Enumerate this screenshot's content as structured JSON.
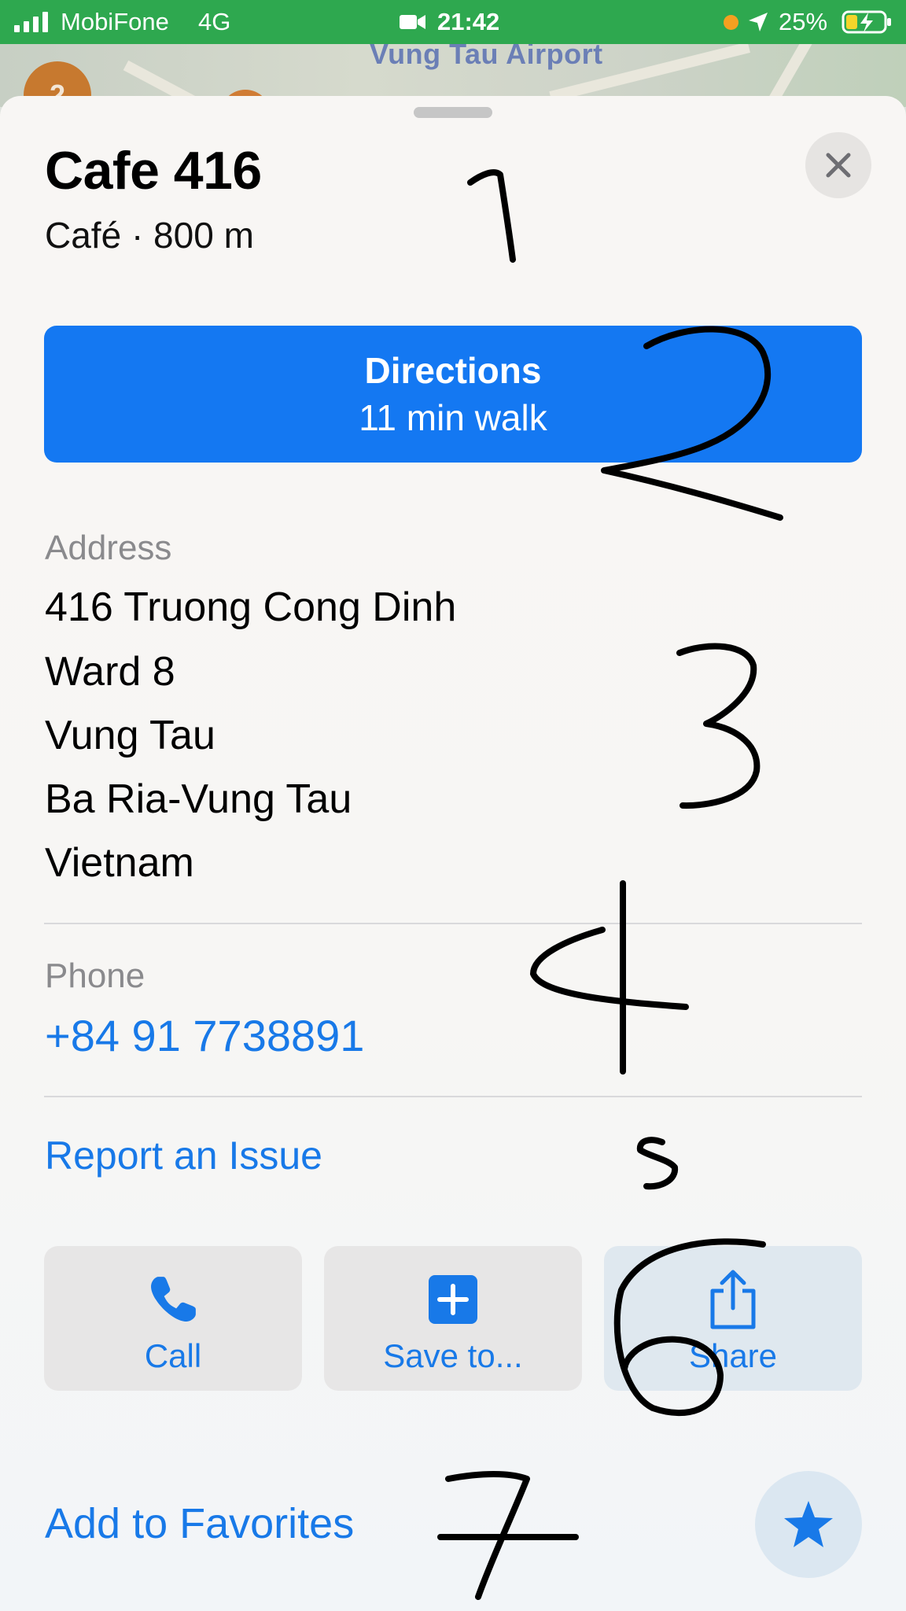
{
  "status_bar": {
    "carrier": "MobiFone",
    "network": "4G",
    "time": "21:42",
    "battery": "25%"
  },
  "map": {
    "label": "Vung Tau Airport",
    "cluster_count": "2"
  },
  "place": {
    "title": "Cafe 416",
    "subtitle": "Café · 800 m"
  },
  "directions": {
    "label": "Directions",
    "sub": "11 min walk"
  },
  "address": {
    "label": "Address",
    "lines": [
      "416 Truong Cong Dinh",
      "Ward 8",
      "Vung Tau",
      "Ba Ria-Vung Tau",
      "Vietnam"
    ]
  },
  "phone": {
    "label": "Phone",
    "value": "+84 91 7738891"
  },
  "report_issue": "Report an Issue",
  "actions": [
    {
      "label": "Call",
      "icon": "phone-icon"
    },
    {
      "label": "Save to...",
      "icon": "plus-icon"
    },
    {
      "label": "Share",
      "icon": "share-icon"
    }
  ],
  "add_favorites": "Add to Favorites",
  "annotations": [
    "1",
    "2",
    "3",
    "4",
    "5",
    "6",
    "7"
  ],
  "colors": {
    "accent": "#1478f2",
    "status_bar": "#2ea84f",
    "link": "#1879e8"
  }
}
